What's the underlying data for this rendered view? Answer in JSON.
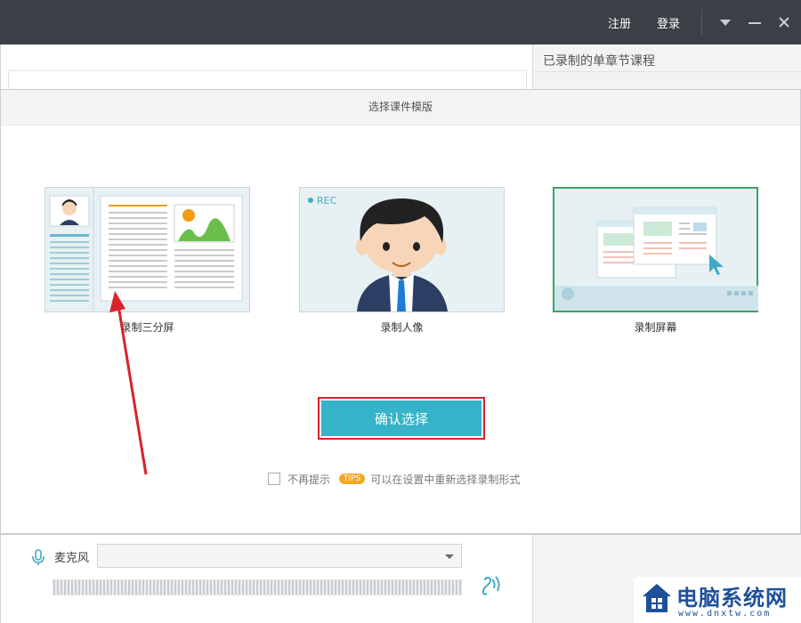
{
  "titlebar": {
    "register_label": "注册",
    "login_label": "登录",
    "menu_icon": "dropdown-triangle-icon",
    "minimize_icon": "minimize-icon",
    "close_icon": "close-icon"
  },
  "background": {
    "right_panel_title": "已录制的单章节课程"
  },
  "dialog": {
    "title": "选择课件模版",
    "templates": [
      {
        "label": "录制三分屏",
        "selected": false
      },
      {
        "label": "录制人像",
        "selected": false,
        "rec_badge": "REC"
      },
      {
        "label": "录制屏幕",
        "selected": true
      }
    ],
    "confirm_label": "确认选择",
    "dont_remind_label": "不再提示",
    "tips_badge": "TIPS",
    "tips_text": "可以在设置中重新选择录制形式"
  },
  "bottom": {
    "mic_label": "麦克风",
    "mic_selected": ""
  },
  "watermark": {
    "text": "电脑系统网",
    "url": "www.dnxtw.com"
  },
  "colors": {
    "titlebar_bg": "#3b4046",
    "accent": "#35b3c8",
    "selected_border": "#3aa466",
    "highlight_red": "#d8232a",
    "tips_orange": "#f5a623"
  }
}
